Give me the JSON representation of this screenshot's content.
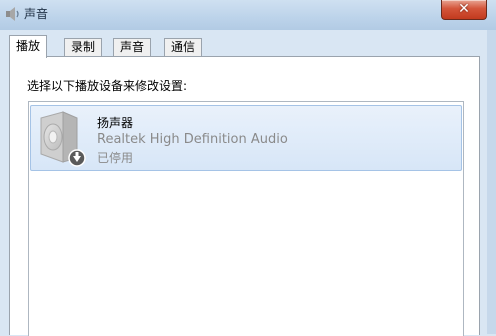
{
  "window": {
    "title": "声音",
    "title_icon": "speaker-icon",
    "close_icon": "close-icon",
    "close_glyph": "✕"
  },
  "tabs": [
    {
      "label": "播放",
      "active": true
    },
    {
      "label": "录制",
      "active": false
    },
    {
      "label": "声音",
      "active": false
    },
    {
      "label": "通信",
      "active": false
    }
  ],
  "playback": {
    "instruction": "选择以下播放设备来修改设置:",
    "devices": [
      {
        "name": "扬声器",
        "description": "Realtek High Definition Audio",
        "status": "已停用",
        "icon": "speaker-device-icon",
        "badge_icon": "disabled-down-arrow-icon"
      }
    ]
  },
  "colors": {
    "selection_bg": "#dbe8f7",
    "selection_border": "#a5c3e6",
    "close_red": "#c23a1e"
  }
}
